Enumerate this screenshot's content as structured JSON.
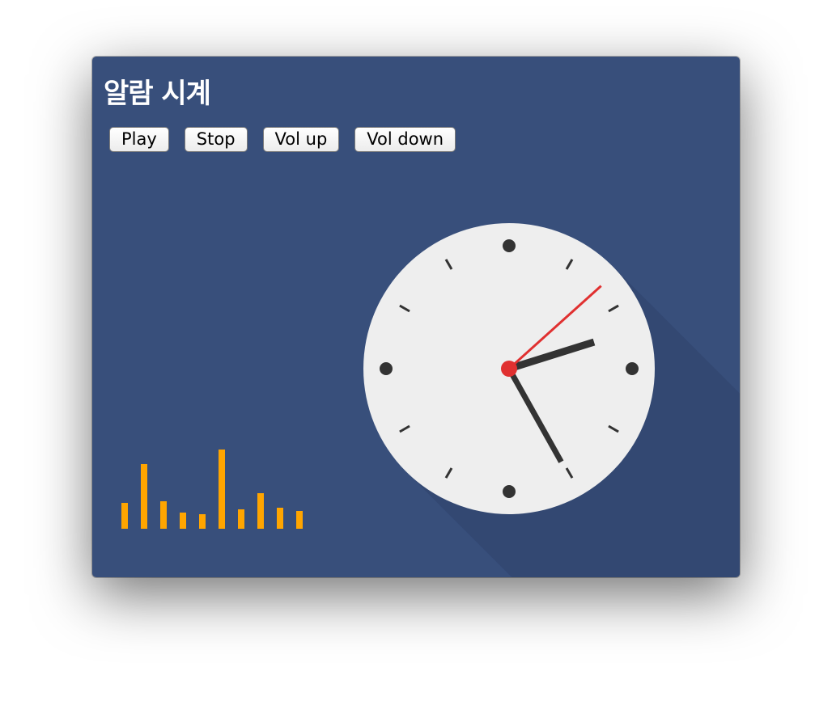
{
  "window": {
    "title": "알람 시계"
  },
  "buttons": {
    "play": "Play",
    "stop": "Stop",
    "vol_up": "Vol up",
    "vol_down": "Vol down"
  },
  "clock": {
    "hours": 2,
    "minutes": 25,
    "seconds": 8,
    "face_color": "#eeeeee",
    "hand_color": "#333333",
    "second_hand_color": "#e03030"
  },
  "visualizer": {
    "color": "#ffa500",
    "levels": [
      32,
      80,
      34,
      20,
      18,
      98,
      24,
      44,
      26,
      22
    ]
  },
  "colors": {
    "background": "#384f7b",
    "shadow": "#334872"
  }
}
